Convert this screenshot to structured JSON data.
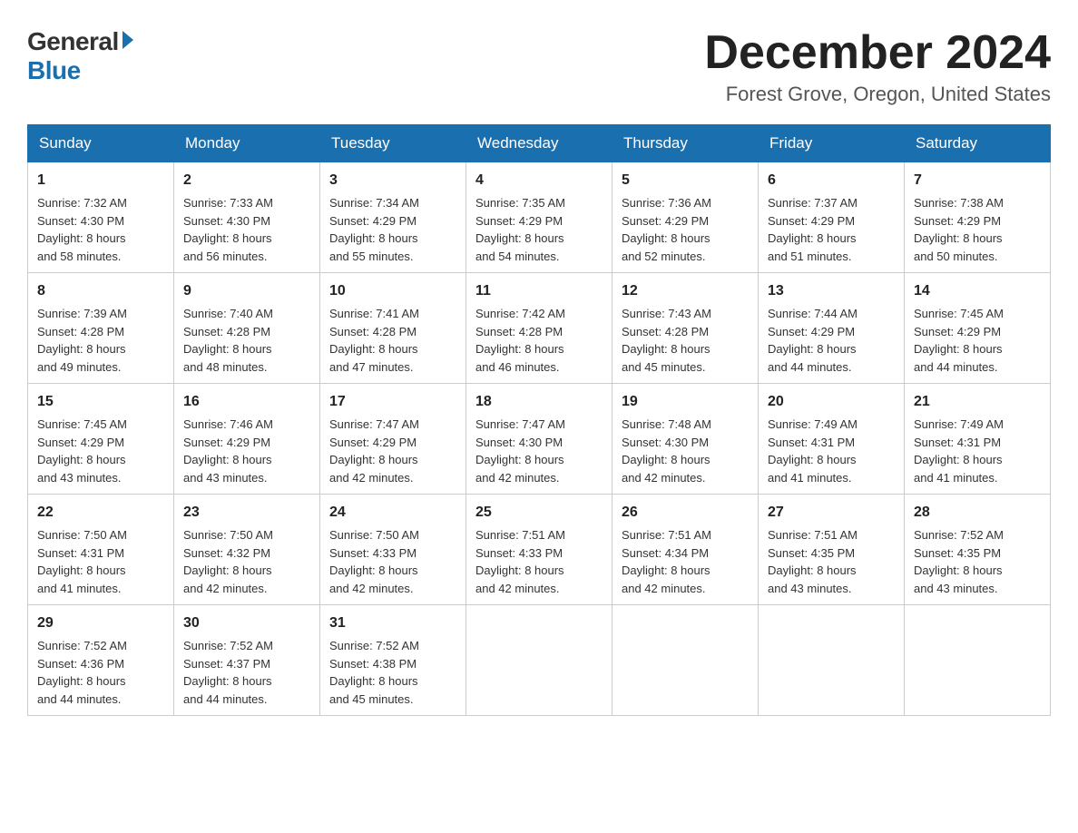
{
  "logo": {
    "general": "General",
    "blue": "Blue"
  },
  "title": {
    "month_year": "December 2024",
    "location": "Forest Grove, Oregon, United States"
  },
  "weekdays": [
    "Sunday",
    "Monday",
    "Tuesday",
    "Wednesday",
    "Thursday",
    "Friday",
    "Saturday"
  ],
  "weeks": [
    [
      {
        "day": "1",
        "sunrise": "Sunrise: 7:32 AM",
        "sunset": "Sunset: 4:30 PM",
        "daylight": "Daylight: 8 hours",
        "daylight2": "and 58 minutes."
      },
      {
        "day": "2",
        "sunrise": "Sunrise: 7:33 AM",
        "sunset": "Sunset: 4:30 PM",
        "daylight": "Daylight: 8 hours",
        "daylight2": "and 56 minutes."
      },
      {
        "day": "3",
        "sunrise": "Sunrise: 7:34 AM",
        "sunset": "Sunset: 4:29 PM",
        "daylight": "Daylight: 8 hours",
        "daylight2": "and 55 minutes."
      },
      {
        "day": "4",
        "sunrise": "Sunrise: 7:35 AM",
        "sunset": "Sunset: 4:29 PM",
        "daylight": "Daylight: 8 hours",
        "daylight2": "and 54 minutes."
      },
      {
        "day": "5",
        "sunrise": "Sunrise: 7:36 AM",
        "sunset": "Sunset: 4:29 PM",
        "daylight": "Daylight: 8 hours",
        "daylight2": "and 52 minutes."
      },
      {
        "day": "6",
        "sunrise": "Sunrise: 7:37 AM",
        "sunset": "Sunset: 4:29 PM",
        "daylight": "Daylight: 8 hours",
        "daylight2": "and 51 minutes."
      },
      {
        "day": "7",
        "sunrise": "Sunrise: 7:38 AM",
        "sunset": "Sunset: 4:29 PM",
        "daylight": "Daylight: 8 hours",
        "daylight2": "and 50 minutes."
      }
    ],
    [
      {
        "day": "8",
        "sunrise": "Sunrise: 7:39 AM",
        "sunset": "Sunset: 4:28 PM",
        "daylight": "Daylight: 8 hours",
        "daylight2": "and 49 minutes."
      },
      {
        "day": "9",
        "sunrise": "Sunrise: 7:40 AM",
        "sunset": "Sunset: 4:28 PM",
        "daylight": "Daylight: 8 hours",
        "daylight2": "and 48 minutes."
      },
      {
        "day": "10",
        "sunrise": "Sunrise: 7:41 AM",
        "sunset": "Sunset: 4:28 PM",
        "daylight": "Daylight: 8 hours",
        "daylight2": "and 47 minutes."
      },
      {
        "day": "11",
        "sunrise": "Sunrise: 7:42 AM",
        "sunset": "Sunset: 4:28 PM",
        "daylight": "Daylight: 8 hours",
        "daylight2": "and 46 minutes."
      },
      {
        "day": "12",
        "sunrise": "Sunrise: 7:43 AM",
        "sunset": "Sunset: 4:28 PM",
        "daylight": "Daylight: 8 hours",
        "daylight2": "and 45 minutes."
      },
      {
        "day": "13",
        "sunrise": "Sunrise: 7:44 AM",
        "sunset": "Sunset: 4:29 PM",
        "daylight": "Daylight: 8 hours",
        "daylight2": "and 44 minutes."
      },
      {
        "day": "14",
        "sunrise": "Sunrise: 7:45 AM",
        "sunset": "Sunset: 4:29 PM",
        "daylight": "Daylight: 8 hours",
        "daylight2": "and 44 minutes."
      }
    ],
    [
      {
        "day": "15",
        "sunrise": "Sunrise: 7:45 AM",
        "sunset": "Sunset: 4:29 PM",
        "daylight": "Daylight: 8 hours",
        "daylight2": "and 43 minutes."
      },
      {
        "day": "16",
        "sunrise": "Sunrise: 7:46 AM",
        "sunset": "Sunset: 4:29 PM",
        "daylight": "Daylight: 8 hours",
        "daylight2": "and 43 minutes."
      },
      {
        "day": "17",
        "sunrise": "Sunrise: 7:47 AM",
        "sunset": "Sunset: 4:29 PM",
        "daylight": "Daylight: 8 hours",
        "daylight2": "and 42 minutes."
      },
      {
        "day": "18",
        "sunrise": "Sunrise: 7:47 AM",
        "sunset": "Sunset: 4:30 PM",
        "daylight": "Daylight: 8 hours",
        "daylight2": "and 42 minutes."
      },
      {
        "day": "19",
        "sunrise": "Sunrise: 7:48 AM",
        "sunset": "Sunset: 4:30 PM",
        "daylight": "Daylight: 8 hours",
        "daylight2": "and 42 minutes."
      },
      {
        "day": "20",
        "sunrise": "Sunrise: 7:49 AM",
        "sunset": "Sunset: 4:31 PM",
        "daylight": "Daylight: 8 hours",
        "daylight2": "and 41 minutes."
      },
      {
        "day": "21",
        "sunrise": "Sunrise: 7:49 AM",
        "sunset": "Sunset: 4:31 PM",
        "daylight": "Daylight: 8 hours",
        "daylight2": "and 41 minutes."
      }
    ],
    [
      {
        "day": "22",
        "sunrise": "Sunrise: 7:50 AM",
        "sunset": "Sunset: 4:31 PM",
        "daylight": "Daylight: 8 hours",
        "daylight2": "and 41 minutes."
      },
      {
        "day": "23",
        "sunrise": "Sunrise: 7:50 AM",
        "sunset": "Sunset: 4:32 PM",
        "daylight": "Daylight: 8 hours",
        "daylight2": "and 42 minutes."
      },
      {
        "day": "24",
        "sunrise": "Sunrise: 7:50 AM",
        "sunset": "Sunset: 4:33 PM",
        "daylight": "Daylight: 8 hours",
        "daylight2": "and 42 minutes."
      },
      {
        "day": "25",
        "sunrise": "Sunrise: 7:51 AM",
        "sunset": "Sunset: 4:33 PM",
        "daylight": "Daylight: 8 hours",
        "daylight2": "and 42 minutes."
      },
      {
        "day": "26",
        "sunrise": "Sunrise: 7:51 AM",
        "sunset": "Sunset: 4:34 PM",
        "daylight": "Daylight: 8 hours",
        "daylight2": "and 42 minutes."
      },
      {
        "day": "27",
        "sunrise": "Sunrise: 7:51 AM",
        "sunset": "Sunset: 4:35 PM",
        "daylight": "Daylight: 8 hours",
        "daylight2": "and 43 minutes."
      },
      {
        "day": "28",
        "sunrise": "Sunrise: 7:52 AM",
        "sunset": "Sunset: 4:35 PM",
        "daylight": "Daylight: 8 hours",
        "daylight2": "and 43 minutes."
      }
    ],
    [
      {
        "day": "29",
        "sunrise": "Sunrise: 7:52 AM",
        "sunset": "Sunset: 4:36 PM",
        "daylight": "Daylight: 8 hours",
        "daylight2": "and 44 minutes."
      },
      {
        "day": "30",
        "sunrise": "Sunrise: 7:52 AM",
        "sunset": "Sunset: 4:37 PM",
        "daylight": "Daylight: 8 hours",
        "daylight2": "and 44 minutes."
      },
      {
        "day": "31",
        "sunrise": "Sunrise: 7:52 AM",
        "sunset": "Sunset: 4:38 PM",
        "daylight": "Daylight: 8 hours",
        "daylight2": "and 45 minutes."
      },
      null,
      null,
      null,
      null
    ]
  ]
}
